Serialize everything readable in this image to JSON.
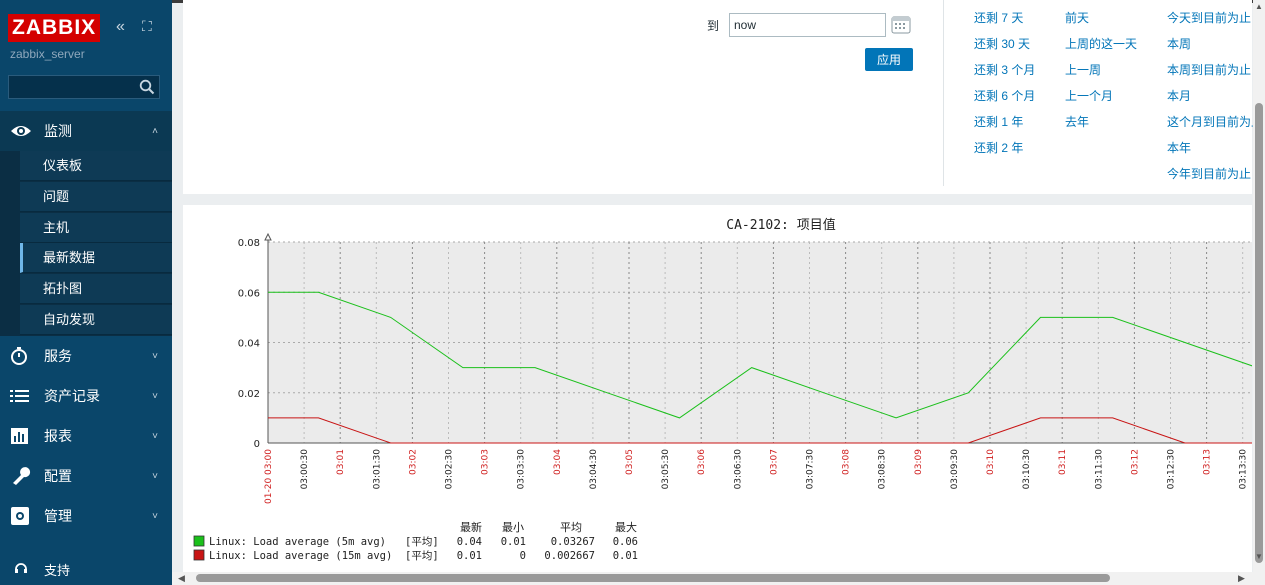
{
  "sidebar": {
    "logo": "ZABBIX",
    "server_name": "zabbix_server",
    "search": {
      "placeholder": ""
    },
    "menu": [
      {
        "label": "监测",
        "icon": "eye-icon",
        "expanded": true
      },
      {
        "label": "服务",
        "icon": "stopwatch-icon"
      },
      {
        "label": "资产记录",
        "icon": "list-icon"
      },
      {
        "label": "报表",
        "icon": "bar-chart-icon"
      },
      {
        "label": "配置",
        "icon": "wrench-icon"
      },
      {
        "label": "管理",
        "icon": "gear-icon"
      }
    ],
    "submenu": [
      "仪表板",
      "问题",
      "主机",
      "最新数据",
      "拓扑图",
      "自动发现"
    ],
    "current_submenu": "最新数据",
    "support": "支持"
  },
  "filter": {
    "to_label": "到",
    "to_value": "now",
    "apply_label": "应用",
    "quick_links": {
      "col1": [
        "还剩 7 天",
        "还剩 30 天",
        "还剩 3 个月",
        "还剩 6 个月",
        "还剩 1 年",
        "还剩 2 年"
      ],
      "col2": [
        "前天",
        "上周的这一天",
        "上一周",
        "上一个月",
        "去年"
      ],
      "col3": [
        "今天到目前为止",
        "本周",
        "本周到目前为止",
        "本月",
        "这个月到目前为止",
        "本年",
        "今年到目前为止"
      ]
    }
  },
  "chart_data": {
    "type": "line",
    "title": "CA-2102: 项目值",
    "ylim": [
      0,
      0.08
    ],
    "y_ticks": [
      "0",
      "0.02",
      "0.04",
      "0.06",
      "0.08"
    ],
    "x_ticks": [
      "01-20 03:00",
      "03:00:30",
      "03:01",
      "03:01:30",
      "03:02",
      "03:02:30",
      "03:03",
      "03:03:30",
      "03:04",
      "03:04:30",
      "03:05",
      "03:05:30",
      "03:06",
      "03:06:30",
      "03:07",
      "03:07:30",
      "03:08",
      "03:08:30",
      "03:09",
      "03:09:30",
      "03:10",
      "03:10:30",
      "03:11",
      "03:11:30",
      "03:12",
      "03:12:30",
      "03:13",
      "03:13:30"
    ],
    "x_minutes": [
      0,
      0.7,
      1.7,
      2.7,
      3.7,
      4.7,
      5.7,
      6.7,
      7.7,
      8.7,
      9.7,
      10.7,
      11.7,
      12.7,
      13.7,
      14.7
    ],
    "series": [
      {
        "name": "Linux: Load average (5m avg)",
        "color": "#1bc01b",
        "values": [
          0.06,
          0.06,
          0.05,
          0.03,
          0.03,
          0.02,
          0.01,
          0.03,
          0.02,
          0.01,
          0.02,
          0.05,
          0.05,
          0.04,
          0.03,
          0.03
        ]
      },
      {
        "name": "Linux: Load average (15m avg)",
        "color": "#c81414",
        "values": [
          0.01,
          0.01,
          0,
          0,
          0,
          0,
          0,
          0,
          0,
          0,
          0,
          0.01,
          0.01,
          0,
          0,
          0
        ]
      }
    ],
    "legend": {
      "headers": [
        "最新",
        "最小",
        "平均",
        "最大"
      ],
      "func": "[平均]",
      "rows": [
        {
          "name": "Linux: Load average (5m avg)",
          "color": "#1bc01b",
          "last": "0.04",
          "min": "0.01",
          "avg": "0.03267",
          "max": "0.06"
        },
        {
          "name": "Linux: Load average (15m avg)",
          "color": "#c81414",
          "last": "0.01",
          "min": "0",
          "avg": "0.002667",
          "max": "0.01"
        }
      ]
    }
  }
}
